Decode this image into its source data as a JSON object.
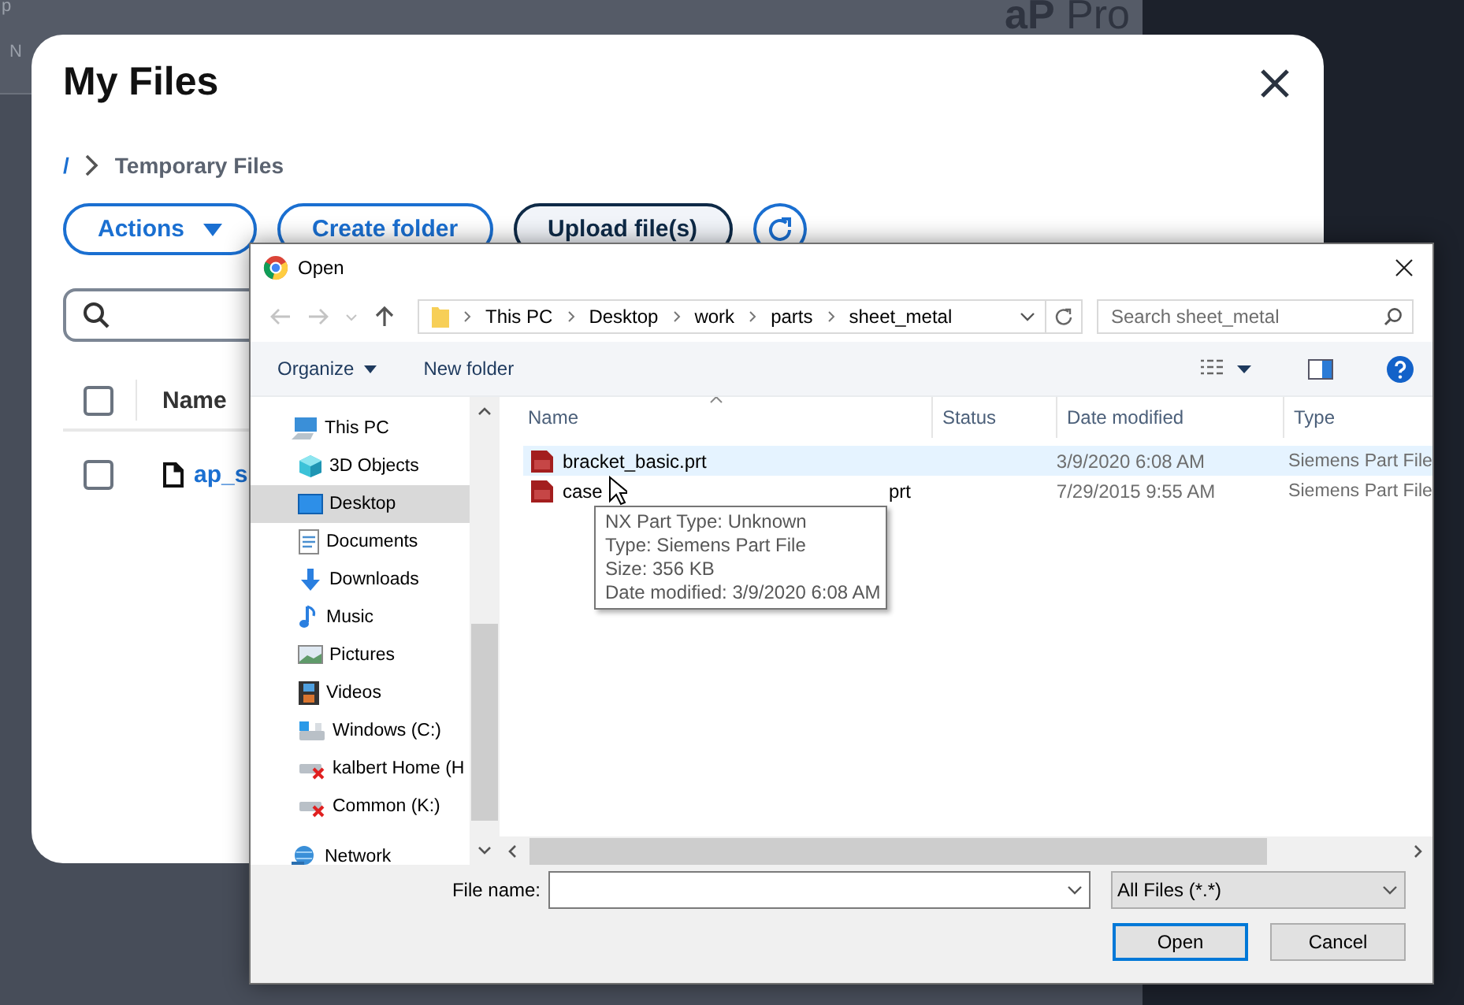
{
  "background_page": {
    "corner_texts": [
      "p",
      "N"
    ],
    "logo": "**aP** Pro"
  },
  "files_modal": {
    "title": "My Files",
    "breadcrumb": [
      {
        "label": "/",
        "kind": "link"
      },
      {
        "label": "Temporary Files",
        "kind": "current"
      }
    ],
    "buttons": [
      {
        "label": "Actions",
        "kind": "dropdown"
      },
      {
        "label": "Create folder",
        "kind": "outline"
      },
      {
        "label": "Upload file(s)",
        "kind": "dark"
      }
    ],
    "table": {
      "columns": [
        {
          "label": "Name"
        }
      ],
      "all_checked": false,
      "rows": [
        {
          "name": "ap_s",
          "checked": false
        }
      ]
    }
  },
  "open_dialog": {
    "title": "Open",
    "path": [
      "This PC",
      "Desktop",
      "work",
      "parts",
      "sheet_metal"
    ],
    "search": {
      "placeholder": "Search sheet_metal"
    },
    "toolbar": [
      {
        "label": "Organize",
        "kind": "menu"
      },
      {
        "label": "New folder",
        "kind": "plain"
      }
    ],
    "nav": [
      {
        "label": "This PC",
        "kind": "pc",
        "selected": false,
        "children": [
          {
            "label": "3D Objects",
            "kind": "cube",
            "selected": false
          },
          {
            "label": "Desktop",
            "kind": "desktop",
            "selected": true
          },
          {
            "label": "Documents",
            "kind": "documents",
            "selected": false
          },
          {
            "label": "Downloads",
            "kind": "downloads",
            "selected": false
          },
          {
            "label": "Music",
            "kind": "music",
            "selected": false
          },
          {
            "label": "Pictures",
            "kind": "pictures",
            "selected": false
          },
          {
            "label": "Videos",
            "kind": "videos",
            "selected": false
          },
          {
            "label": "Windows (C:)",
            "kind": "drive",
            "selected": false
          },
          {
            "label": "kalbert Home (H",
            "kind": "netdrive",
            "selected": false
          },
          {
            "label": "Common (K:)",
            "kind": "netdrive",
            "selected": false
          }
        ]
      },
      {
        "label": "Network",
        "kind": "network",
        "selected": false
      }
    ],
    "columns": [
      {
        "label": "Name",
        "sorted": true
      },
      {
        "label": "Status",
        "sorted": false
      },
      {
        "label": "Date modified",
        "sorted": false
      },
      {
        "label": "Type",
        "sorted": false
      }
    ],
    "files": [
      {
        "name": "bracket_basic.prt",
        "date": "3/9/2020 6:08 AM",
        "type": "Siemens Part File",
        "selected": true
      },
      {
        "name": "case",
        "name_tail": "prt",
        "date": "7/29/2015 9:55 AM",
        "type": "Siemens Part File",
        "selected": false
      }
    ],
    "tooltip": [
      "NX Part Type: Unknown",
      "Type: Siemens Part File",
      "Size: 356 KB",
      "Date modified: 3/9/2020 6:08 AM"
    ],
    "file_name": {
      "label": "File name:"
    },
    "filter": "All Files (*.*)",
    "buttons": [
      {
        "label": "Open",
        "default": true
      },
      {
        "label": "Cancel",
        "default": false
      }
    ]
  }
}
